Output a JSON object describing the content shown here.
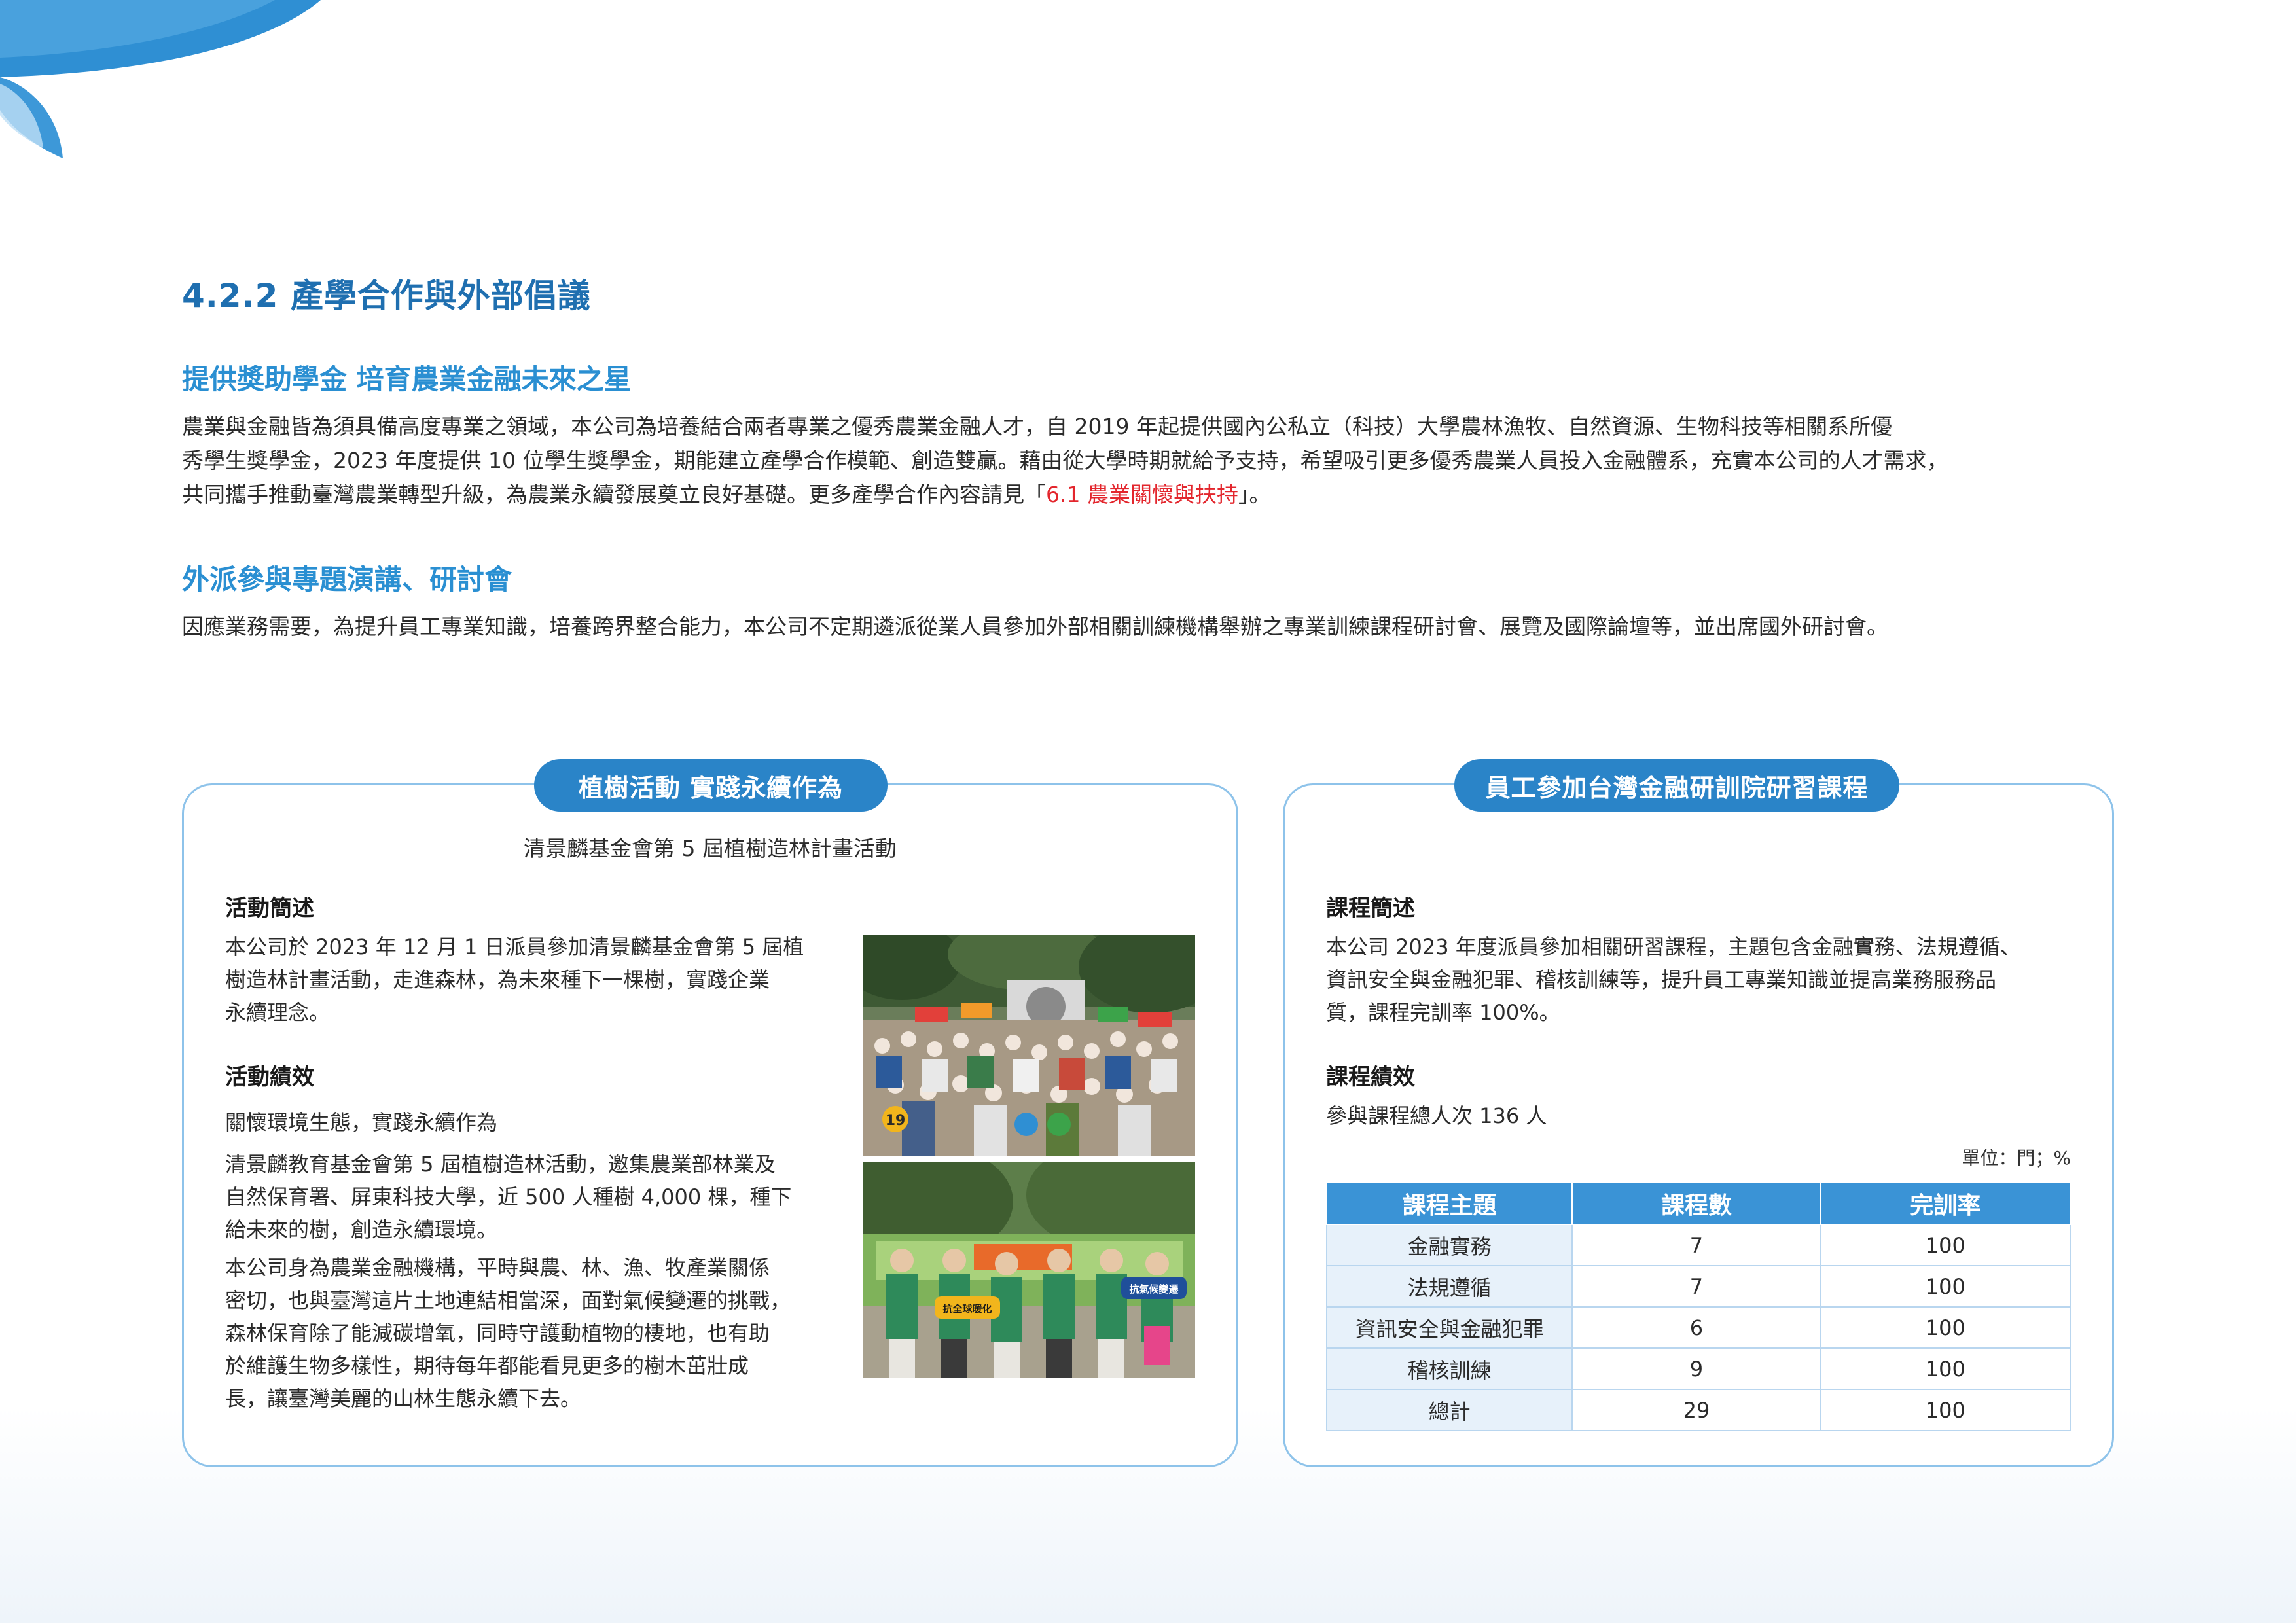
{
  "section_title": "4.2.2 產學合作與外部倡議",
  "scholarship": {
    "heading": "提供獎助學金 培育農業金融未來之星",
    "line1": "農業與金融皆為須具備高度專業之領域，本公司為培養結合兩者專業之優秀農業金融人才，自 2019 年起提供國內公私立（科技）大學農林漁牧、自然資源、生物科技等相關系所優",
    "line2": "秀學生獎學金，2023 年度提供 10 位學生獎學金，期能建立產學合作模範、創造雙贏。藉由從大學時期就給予支持，希望吸引更多優秀農業人員投入金融體系，充實本公司的人才需求，",
    "line3_pre": "共同攜手推動臺灣農業轉型升級，為農業永續發展奠立良好基礎。更多產學合作內容請見「",
    "line3_link": "6.1 農業關懷與扶持",
    "line3_post": "」。"
  },
  "external": {
    "heading": "外派參與專題演講、研討會",
    "line1": "因應業務需要，為提升員工專業知識，培養跨界整合能力，本公司不定期遴派從業人員參加外部相關訓練機構舉辦之專業訓練課程研討會、展覽及國際論壇等，並出席國外研討會。"
  },
  "tree_panel": {
    "pill": "植樹活動  實踐永續作為",
    "subtitle": "清景麟基金會第 5 屆植樹造林計畫活動",
    "summary_label": "活動簡述",
    "summary": [
      "本公司於 2023 年 12 月 1 日派員參加清景麟基金會第 5 屆植",
      "樹造林計畫活動，走進森林，為未來種下一棵樹，實踐企業",
      "永續理念。"
    ],
    "results_label": "活動績效",
    "r1": "關懷環境生態，實踐永續作為",
    "r2": [
      "清景麟教育基金會第 5 屆植樹造林活動，邀集農業部林業及",
      "自然保育署、屏東科技大學，近 500 人種樹 4,000 棵，種下",
      "給未來的樹，創造永續環境。"
    ],
    "r3": [
      "本公司身為農業金融機構，平時與農、林、漁、牧產業關係",
      "密切，也與臺灣這片土地連結相當深，面對氣候變遷的挑戰，",
      "森林保育除了能減碳增氧，同時守護動植物的棲地，也有助",
      "於維護生物多樣性，期待每年都能看見更多的樹木茁壯成",
      "長，讓臺灣美麗的山林生態永續下去。"
    ],
    "photo_sign_1": "19",
    "photo_sign_2": "抗全球暖化",
    "photo_sign_3": "抗氣候變遷"
  },
  "course_panel": {
    "pill": "員工參加台灣金融研訓院研習課程",
    "summary_label": "課程簡述",
    "summary": [
      "本公司 2023 年度派員參加相關研習課程，主題包含金融實務、法規遵循、",
      "資訊安全與金融犯罪、稽核訓練等，提升員工專業知識並提高業務服務品",
      "質，課程完訓率 100%。"
    ],
    "results_label": "課程績效",
    "results": "參與課程總人次 136 人",
    "unit": "單位：門；%",
    "headers": [
      "課程主題",
      "課程數",
      "完訓率"
    ],
    "rows": [
      [
        "金融實務",
        "7",
        "100"
      ],
      [
        "法規遵循",
        "7",
        "100"
      ],
      [
        "資訊安全與金融犯罪",
        "6",
        "100"
      ],
      [
        "稽核訓練",
        "9",
        "100"
      ],
      [
        "總計",
        "29",
        "100"
      ]
    ]
  },
  "colors": {
    "title": "#1f6fb0",
    "accent": "#2a84c8",
    "link": "#e3262d",
    "border": "#8ec3ea"
  }
}
